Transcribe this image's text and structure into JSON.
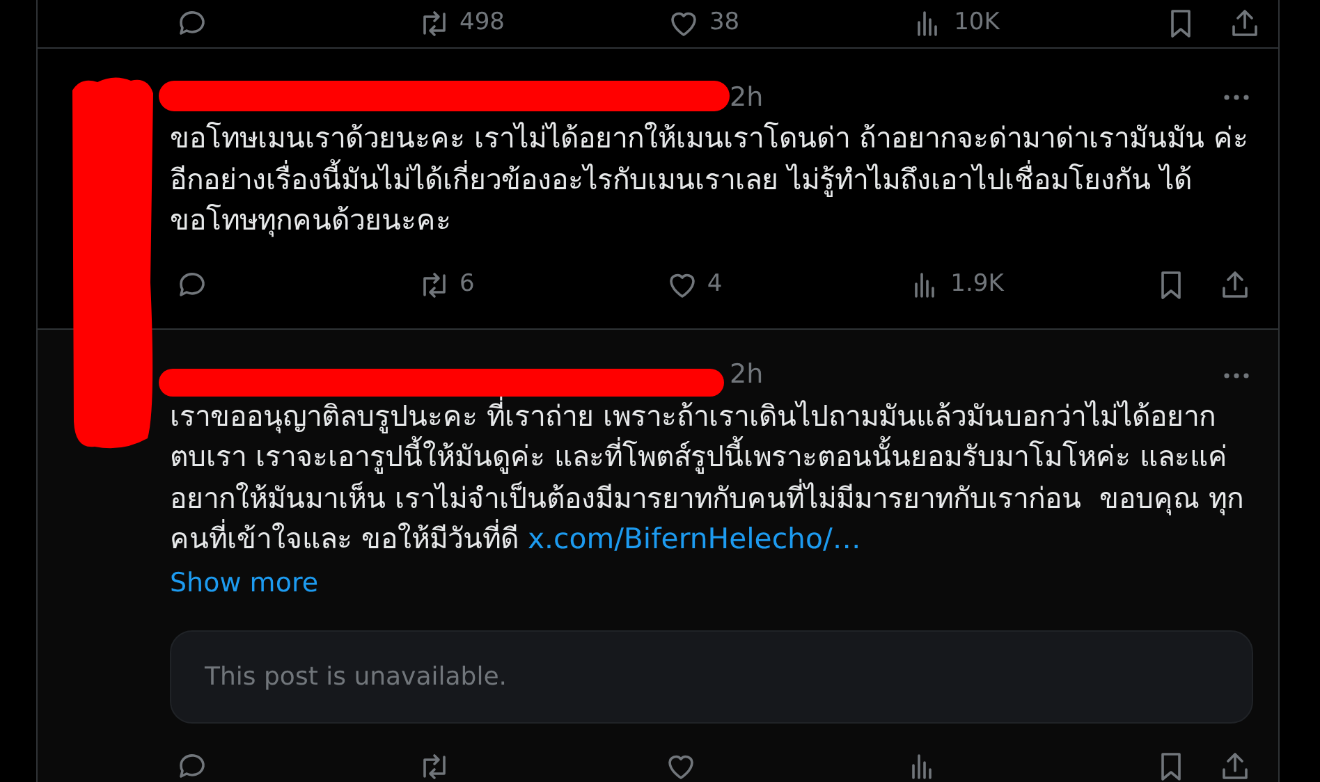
{
  "posts": [
    {
      "actions": {
        "reposts": "498",
        "likes": "38",
        "views": "10K"
      }
    },
    {
      "time": "2h",
      "text": "ขอโทษเมนเราด้วยนะคะ เราไม่ได้อยากให้เมนเราโดนด่า ถ้าอยากจะด่ามาด่าเรามันมัน ค่ะ อีกอย่างเรื่องนี้มันไม่ได้เกี่ยวข้องอะไรกับเมนเราเลย ไม่รู้ทำไมถึงเอาไปเชื่อมโยงกัน ได้ ขอโทษทุกคนด้วยนะคะ",
      "actions": {
        "reposts": "6",
        "likes": "4",
        "views": "1.9K"
      }
    },
    {
      "time": "2h",
      "text": "เราขออนุญาติลบรูปนะคะ ที่เราถ่าย เพราะถ้าเราเดินไปถามมันแล้วมันบอกว่าไม่ได้อยาก ตบเรา เราจะเอารูปนี้ให้มันดูค่ะ และที่โพตส์รูปนี้เพราะตอนนั้นยอมรับมาโมโหค่ะ และแค่ อยากให้มันมาเห็น เราไม่จำเป็นต้องมีมารยาทกับคนที่ไม่มีมารยาทกับเราก่อน  ขอบคุณ ทุกคนที่เข้าใจและ ขอให้มีวันที่ดี",
      "link": "x.com/BifernHelecho/…",
      "show_more": "Show more",
      "quote": "This post is unavailable."
    }
  ]
}
